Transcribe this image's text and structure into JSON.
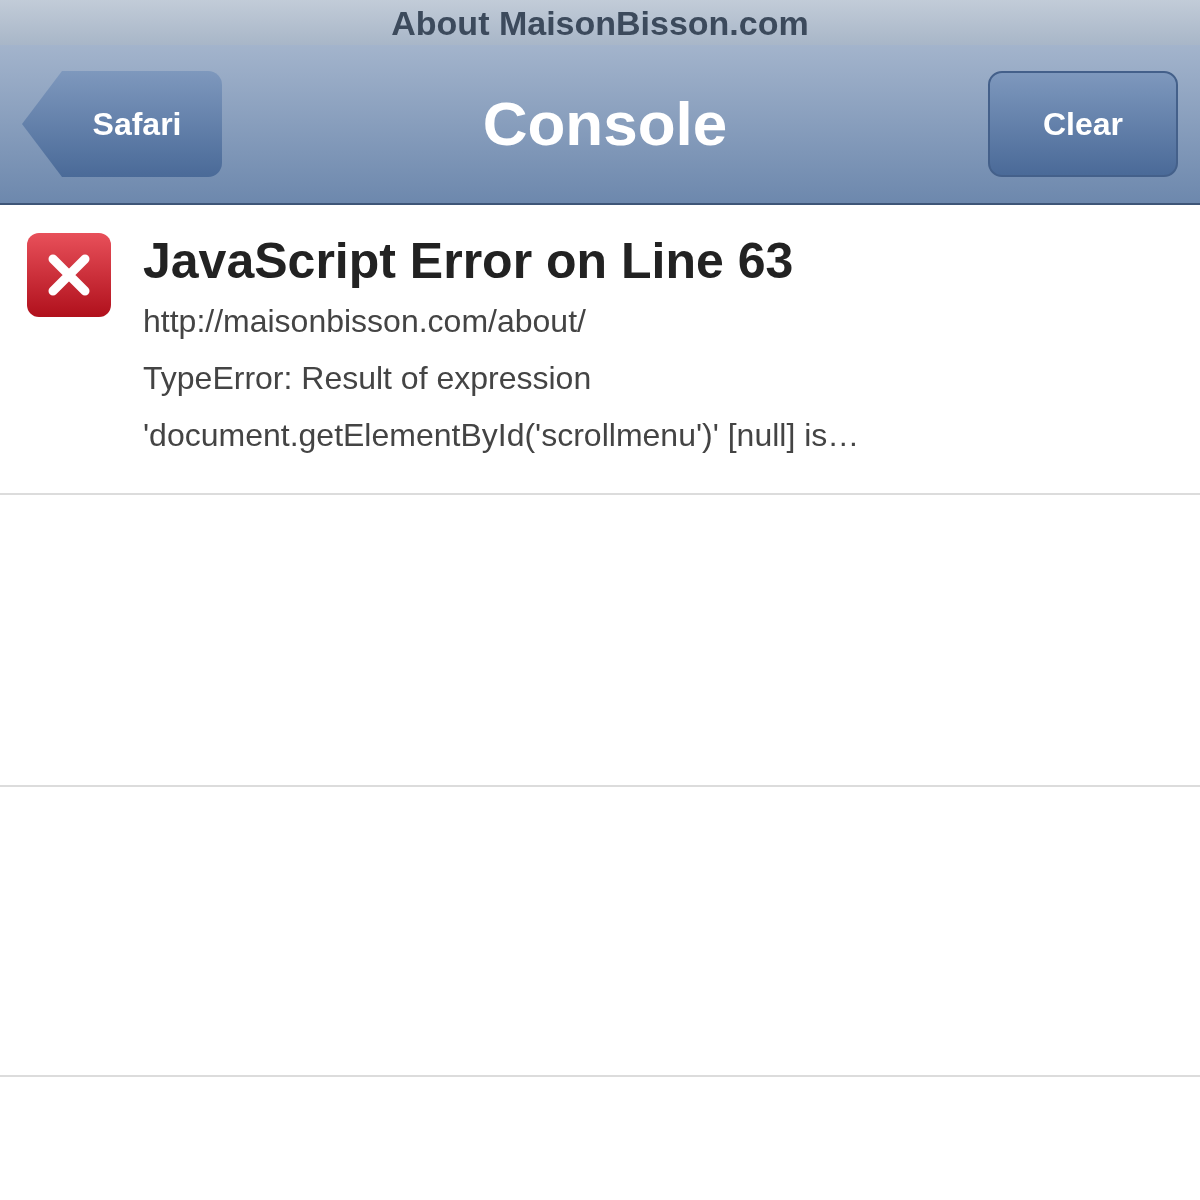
{
  "page_title": "About MaisonBisson.com",
  "nav": {
    "back_button": "Safari",
    "title": "Console",
    "action_button": "Clear"
  },
  "messages": [
    {
      "kind": "error",
      "title": "JavaScript Error on Line 63",
      "lines": [
        "http://maisonbisson.com/about/",
        "TypeError: Result of expression",
        "'document.getElementById('scrollmenu')' [null] is…"
      ]
    }
  ]
}
